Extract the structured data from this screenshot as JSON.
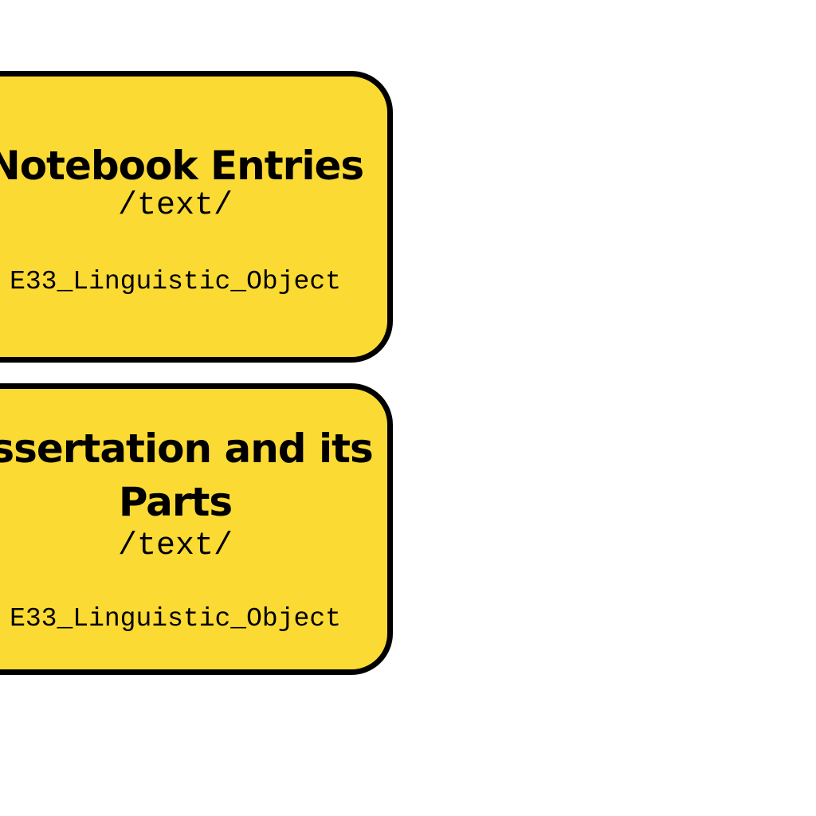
{
  "colors": {
    "node_fill": "#FBDA34",
    "node_border": "#000000",
    "text": "#000000",
    "background": "#FFFFFF"
  },
  "nodes": [
    {
      "title_lines": [
        "Notebook Entries"
      ],
      "tag": "/text/",
      "class": "E33_Linguistic_Object"
    },
    {
      "title_lines": [
        "issertation and its",
        "Parts"
      ],
      "tag": "/text/",
      "class": "E33_Linguistic_Object"
    }
  ]
}
